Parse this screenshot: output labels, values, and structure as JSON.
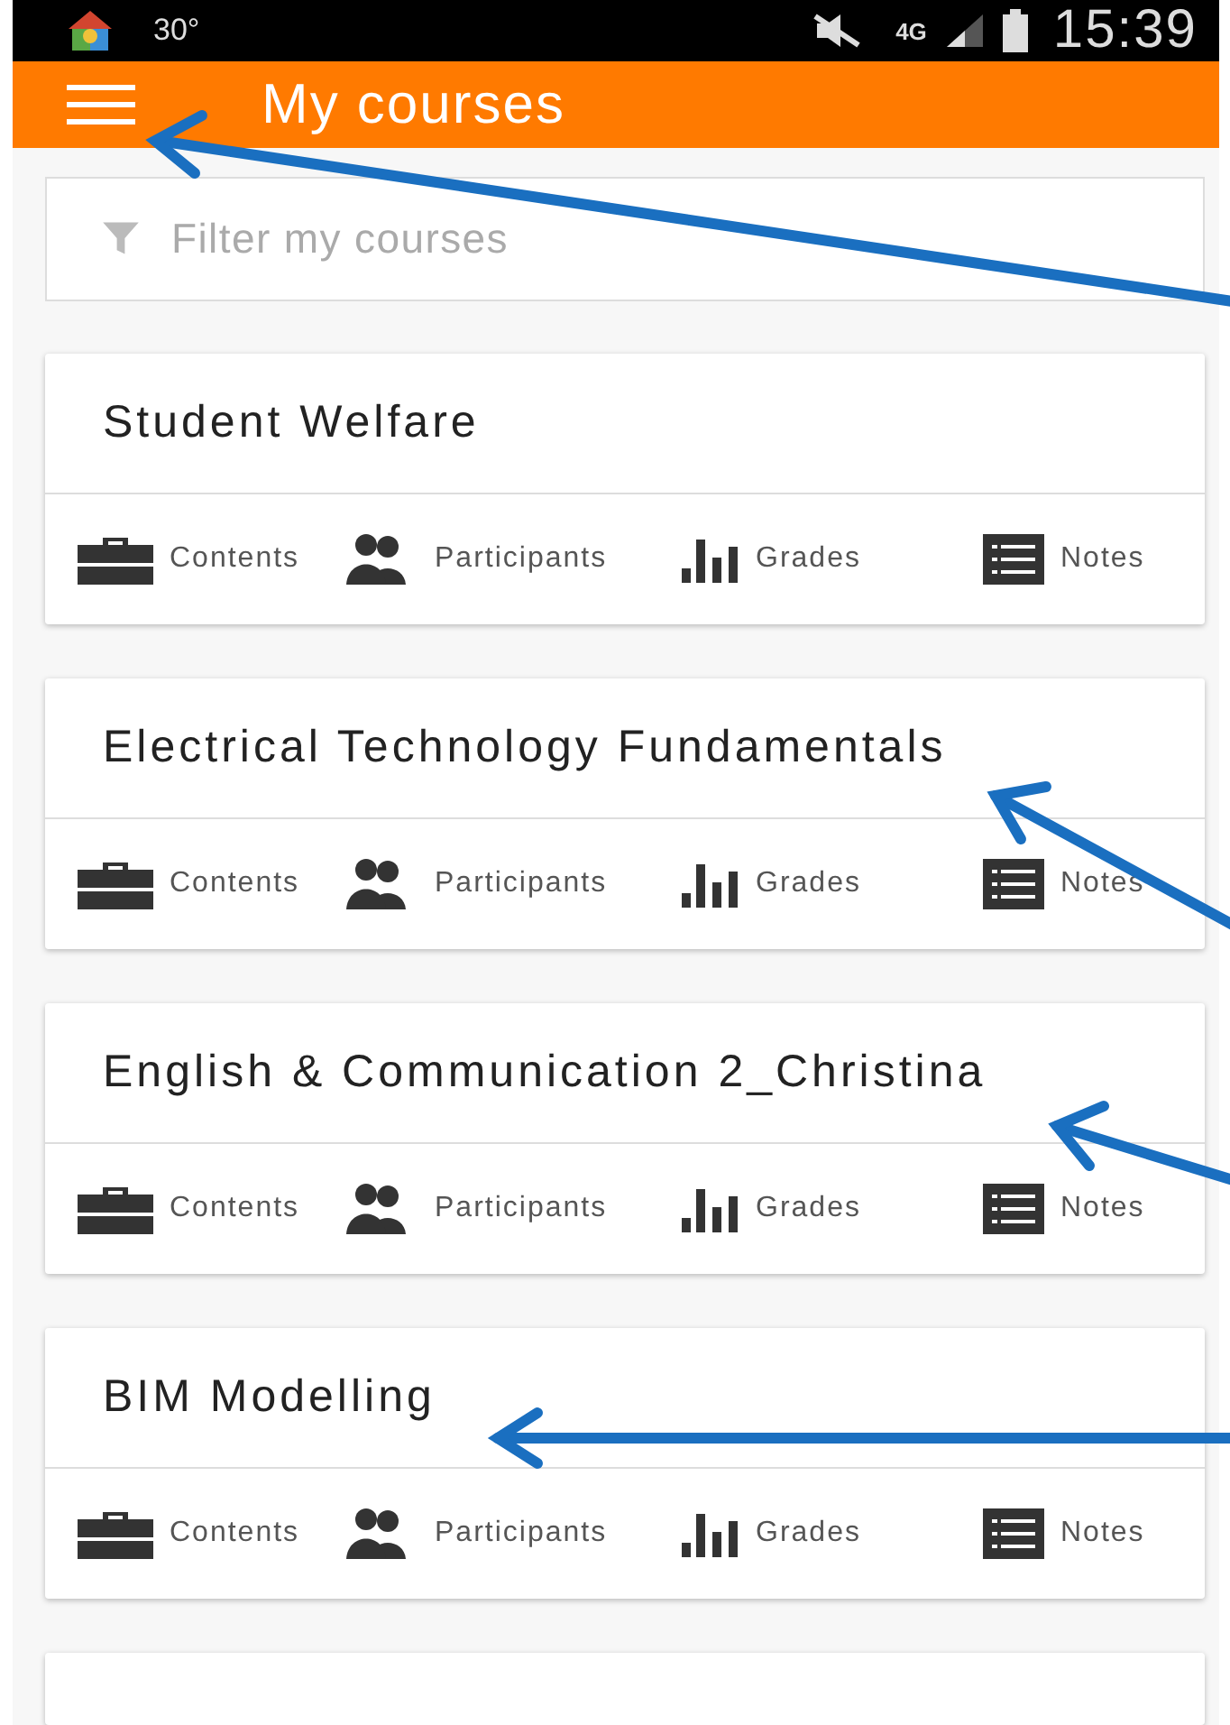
{
  "status_bar": {
    "temperature": "30°",
    "network": "4G",
    "time": "15:39"
  },
  "app_bar": {
    "title": "My courses"
  },
  "filter": {
    "placeholder": "Filter my courses"
  },
  "courses": [
    {
      "title": "Student Welfare",
      "actions": [
        {
          "kind": "contents",
          "label": "Contents"
        },
        {
          "kind": "participants",
          "label": "Participants"
        },
        {
          "kind": "grades",
          "label": "Grades"
        },
        {
          "kind": "notes",
          "label": "Notes"
        }
      ]
    },
    {
      "title": "Electrical Technology Fundamentals",
      "actions": [
        {
          "kind": "contents",
          "label": "Contents"
        },
        {
          "kind": "participants",
          "label": "Participants"
        },
        {
          "kind": "grades",
          "label": "Grades"
        },
        {
          "kind": "notes",
          "label": "Notes"
        }
      ]
    },
    {
      "title": "English & Communication 2_Christina",
      "actions": [
        {
          "kind": "contents",
          "label": "Contents"
        },
        {
          "kind": "participants",
          "label": "Participants"
        },
        {
          "kind": "grades",
          "label": "Grades"
        },
        {
          "kind": "notes",
          "label": "Notes"
        }
      ]
    },
    {
      "title": "BIM Modelling",
      "actions": [
        {
          "kind": "contents",
          "label": "Contents"
        },
        {
          "kind": "participants",
          "label": "Participants"
        },
        {
          "kind": "grades",
          "label": "Grades"
        },
        {
          "kind": "notes",
          "label": "Notes"
        }
      ]
    }
  ]
}
